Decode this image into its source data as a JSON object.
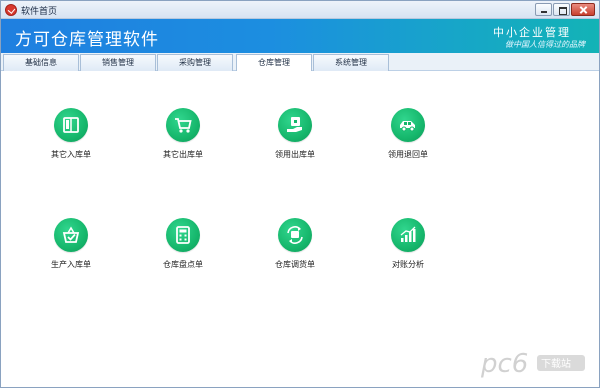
{
  "window": {
    "title": "软件首页"
  },
  "banner": {
    "app_title": "方可仓库管理软件",
    "brand_top": "中小企业管理",
    "brand_sub": "做中国人信得过的品牌"
  },
  "tabs": [
    {
      "label": "基础信息",
      "active": false
    },
    {
      "label": "销售管理",
      "active": false
    },
    {
      "label": "采购管理",
      "active": false
    },
    {
      "label": "仓库管理",
      "active": true
    },
    {
      "label": "系统管理",
      "active": false
    }
  ],
  "tiles": [
    {
      "label": "其它入库单",
      "icon": "book-icon"
    },
    {
      "label": "其它出库单",
      "icon": "cart-icon"
    },
    {
      "label": "领用出库单",
      "icon": "hand-box-icon"
    },
    {
      "label": "领用退回单",
      "icon": "car-icon"
    },
    {
      "label": "生产入库单",
      "icon": "basket-check-icon"
    },
    {
      "label": "仓库盘点单",
      "icon": "calculator-icon"
    },
    {
      "label": "仓库调货单",
      "icon": "transfer-icon"
    },
    {
      "label": "对账分析",
      "icon": "bar-chart-icon"
    }
  ],
  "watermark": {
    "text": "pc6下载站"
  },
  "colors": {
    "accent": "#1c8ee0",
    "icon_green": "#16b76c"
  }
}
